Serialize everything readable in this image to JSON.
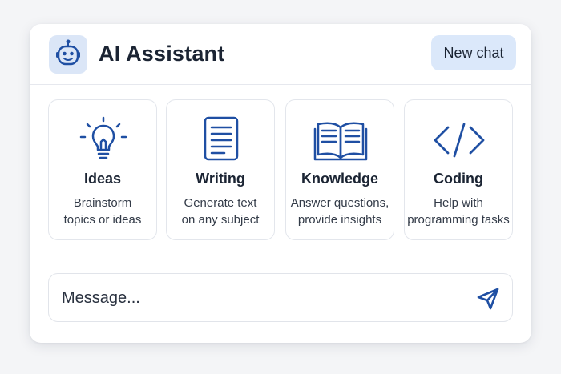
{
  "header": {
    "title": "AI Assistant",
    "logo_icon": "robot-icon",
    "new_chat_label": "New chat"
  },
  "tiles": [
    {
      "icon": "lightbulb-icon",
      "title": "Ideas",
      "description": "Brainstorm\ntopics or ideas"
    },
    {
      "icon": "document-icon",
      "title": "Writing",
      "description": "Generate text\non any subject"
    },
    {
      "icon": "open-book-icon",
      "title": "Knowledge",
      "description": "Answer questions,\nprovide insights"
    },
    {
      "icon": "code-icon",
      "title": "Coding",
      "description": "Help with\nprogramming tasks"
    }
  ],
  "composer": {
    "placeholder": "Message...",
    "value": "",
    "send_icon": "send-icon"
  },
  "colors": {
    "accent": "#1f4fa3",
    "accent_light": "#dbe8fa",
    "text": "#1b2433",
    "border": "#e3e6ec"
  }
}
